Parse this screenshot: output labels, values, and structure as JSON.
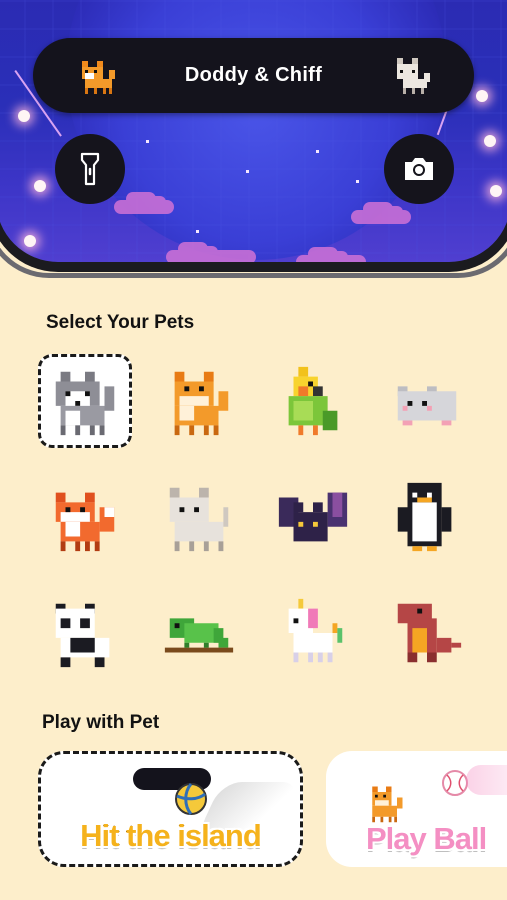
{
  "island": {
    "title": "Doddy & Chiff"
  },
  "sections": {
    "select_pets": "Select Your Pets",
    "play_with_pet": "Play with Pet"
  },
  "pets": [
    {
      "icon": "husky-icon",
      "selected": true
    },
    {
      "icon": "shiba-icon",
      "selected": false
    },
    {
      "icon": "parrot-icon",
      "selected": false
    },
    {
      "icon": "hamster-icon",
      "selected": false
    },
    {
      "icon": "fox-icon",
      "selected": false
    },
    {
      "icon": "white-cat-icon",
      "selected": false
    },
    {
      "icon": "bat-icon",
      "selected": false
    },
    {
      "icon": "penguin-icon",
      "selected": false
    },
    {
      "icon": "panda-icon",
      "selected": false
    },
    {
      "icon": "chameleon-icon",
      "selected": false
    },
    {
      "icon": "unicorn-icon",
      "selected": false
    },
    {
      "icon": "dinosaur-icon",
      "selected": false
    }
  ],
  "games": [
    {
      "label": "Hit the island",
      "selected": true
    },
    {
      "label": "Play Ball",
      "selected": false
    }
  ],
  "colors": {
    "background": "#fdeecb",
    "sky": "#2b2bb3",
    "hit_label": "#f5b21c",
    "ball_label": "#f48fc3"
  }
}
